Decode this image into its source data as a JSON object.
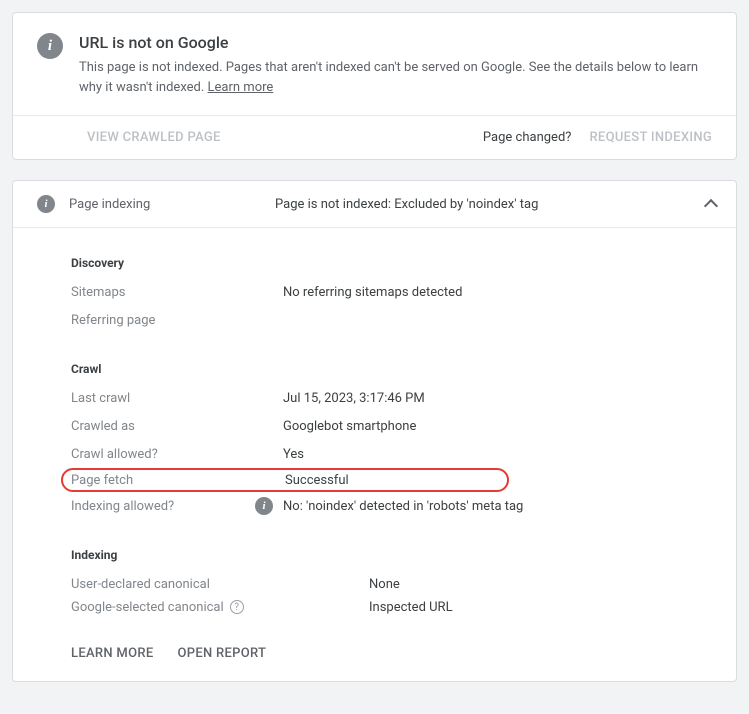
{
  "status": {
    "title": "URL is not on Google",
    "description_pre": "This page is not indexed. Pages that aren't indexed can't be served on Google. See the details below to learn why it wasn't indexed. ",
    "learn_more": "Learn more"
  },
  "actions": {
    "view_crawled": "View crawled page",
    "page_changed": "Page changed?",
    "request_indexing": "Request indexing"
  },
  "accordion": {
    "title": "Page indexing",
    "status": "Page is not indexed: Excluded by 'noindex' tag"
  },
  "sections": {
    "discovery": {
      "header": "Discovery",
      "rows": {
        "sitemaps": {
          "label": "Sitemaps",
          "value": "No referring sitemaps detected"
        },
        "referring_page": {
          "label": "Referring page",
          "value": ""
        }
      }
    },
    "crawl": {
      "header": "Crawl",
      "rows": {
        "last_crawl": {
          "label": "Last crawl",
          "value": "Jul 15, 2023, 3:17:46 PM"
        },
        "crawled_as": {
          "label": "Crawled as",
          "value": "Googlebot smartphone"
        },
        "crawl_allowed": {
          "label": "Crawl allowed?",
          "value": "Yes"
        },
        "page_fetch": {
          "label": "Page fetch",
          "value": "Successful"
        },
        "indexing_allowed": {
          "label": "Indexing allowed?",
          "value": "No: 'noindex' detected in 'robots' meta tag"
        }
      }
    },
    "indexing": {
      "header": "Indexing",
      "rows": {
        "user_canonical": {
          "label": "User-declared canonical",
          "value": "None"
        },
        "google_canonical": {
          "label": "Google-selected canonical",
          "value": "Inspected URL"
        }
      }
    }
  },
  "footer": {
    "learn_more": "Learn more",
    "open_report": "Open report"
  }
}
